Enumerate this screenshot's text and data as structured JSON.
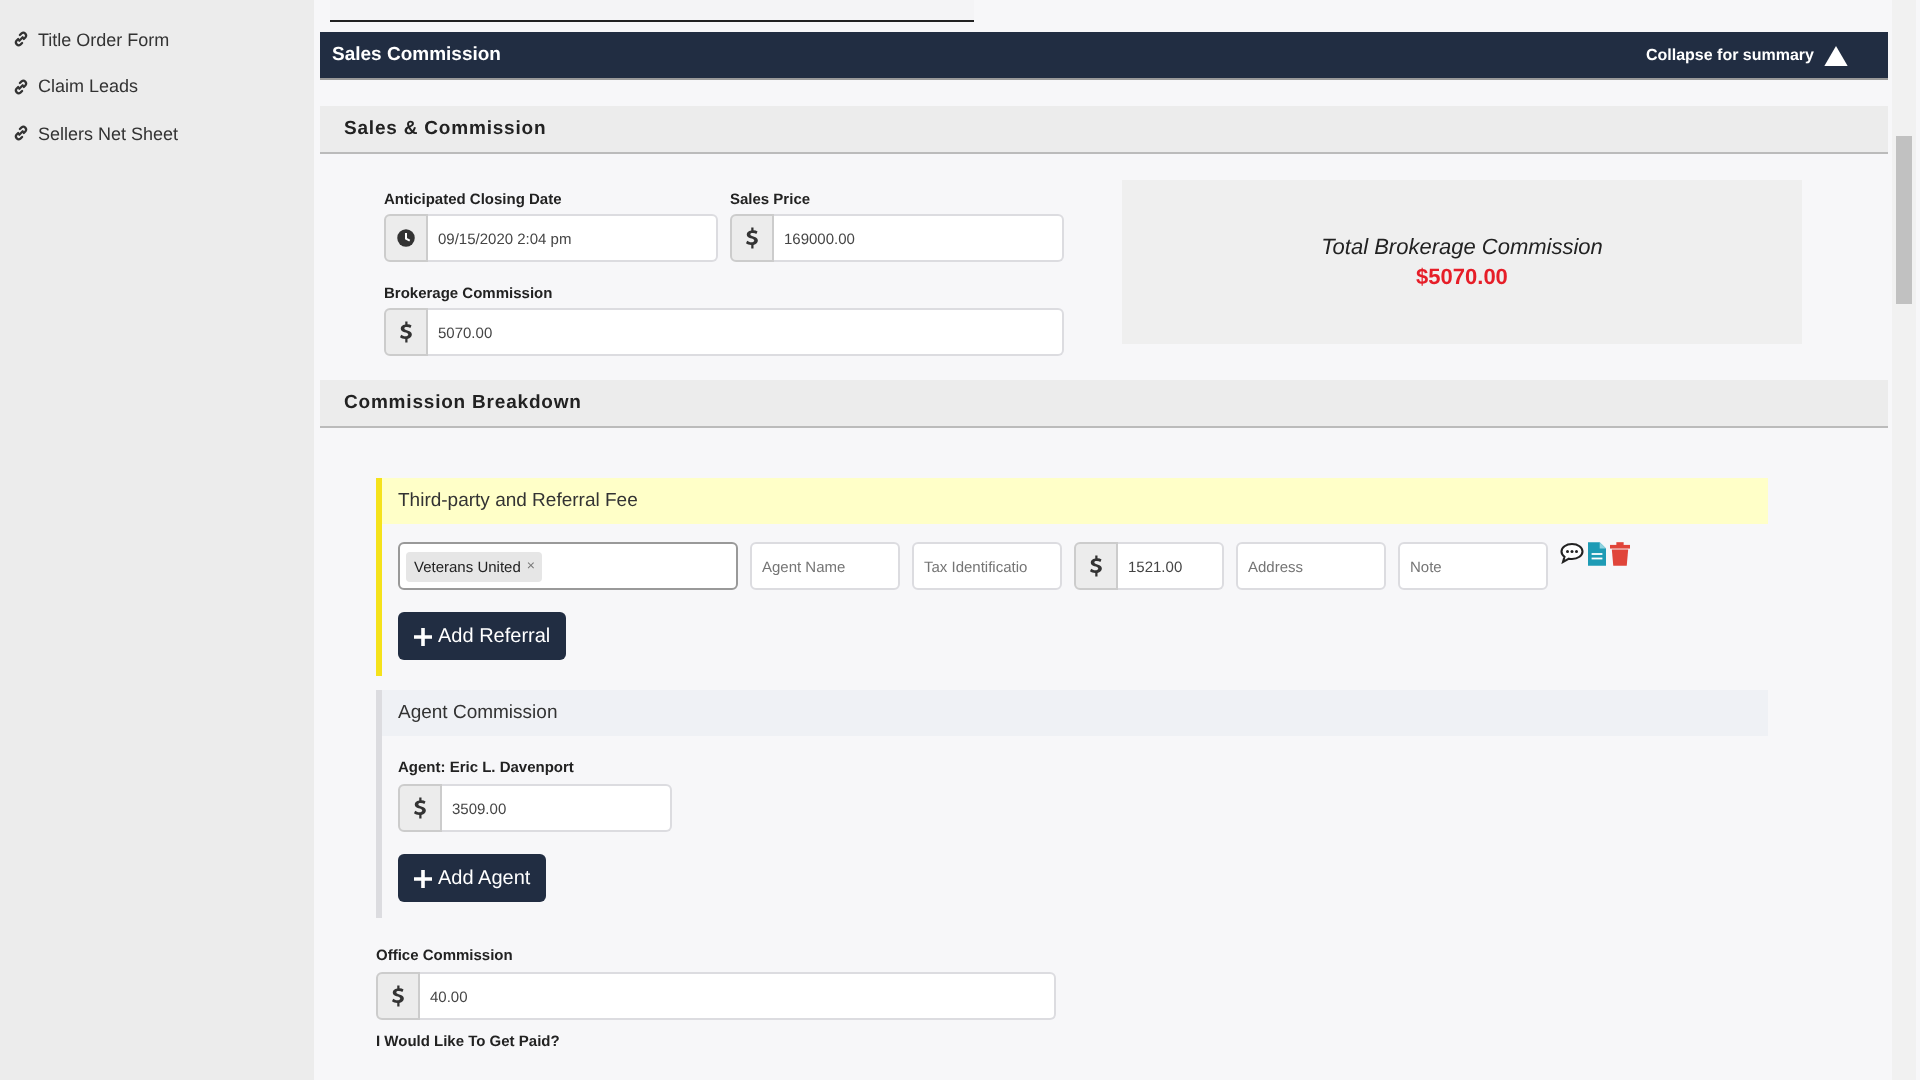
{
  "sidebar": {
    "items": [
      {
        "label": "Title Order Form"
      },
      {
        "label": "Claim Leads"
      },
      {
        "label": "Sellers Net Sheet"
      }
    ]
  },
  "panel": {
    "title": "Sales Commission",
    "collapse_label": "Collapse for summary"
  },
  "sales": {
    "title": "Sales & Commission",
    "fields": [
      {
        "label": "Anticipated Closing Date",
        "value": "09/15/2020 2:04 pm",
        "kind": "date"
      },
      {
        "label": "Sales Price",
        "value": "169000.00",
        "kind": "money"
      },
      {
        "label": "Brokerage Commission",
        "value": "5070.00",
        "kind": "money"
      }
    ],
    "summary": {
      "title": "Total Brokerage Commission",
      "amount": "$5070.00"
    }
  },
  "breakdown": {
    "title": "Commission Breakdown",
    "referral": {
      "title": "Third-party and Referral Fee",
      "tag": "Veterans United",
      "tag_remove": "×",
      "agent_name_placeholder": "Agent Name",
      "tax_id_placeholder": "Tax Identificatio",
      "amount": "1521.00",
      "address_placeholder": "Address",
      "note_placeholder": "Note",
      "add_button": "Add Referral"
    },
    "agent": {
      "title": "Agent Commission",
      "agent_label": "Agent: Eric L. Davenport",
      "amount": "3509.00",
      "add_button": "Add Agent"
    },
    "office": {
      "label": "Office Commission",
      "amount": "40.00"
    },
    "paid_question": "I Would Like To Get Paid?"
  }
}
